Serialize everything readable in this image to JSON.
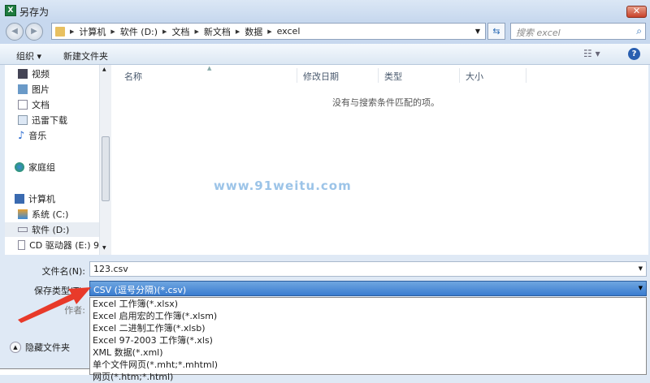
{
  "window": {
    "title": "另存为",
    "app_icon": "X",
    "close": "✕"
  },
  "address": {
    "crumbs": [
      "计算机",
      "软件 (D:)",
      "文档",
      "新文档",
      "数据",
      "excel"
    ],
    "search_placeholder": "搜索 excel"
  },
  "toolbar": {
    "organize": "组织 ▾",
    "new_folder": "新建文件夹"
  },
  "nav": {
    "items": [
      "视频",
      "图片",
      "文档",
      "迅雷下载",
      "音乐",
      "家庭组",
      "计算机",
      "系统 (C:)",
      "软件 (D:)",
      "CD 驱动器 (E:) 9"
    ]
  },
  "columns": [
    "名称",
    "修改日期",
    "类型",
    "大小"
  ],
  "empty_message": "没有与搜索条件匹配的项。",
  "watermark": "www.91weitu.com",
  "form": {
    "filename_label": "文件名(N):",
    "filename": "123.csv",
    "type_label": "保存类型(T):",
    "type_value": "CSV (逗号分隔)(*.csv)",
    "author_label": "作者:",
    "hide_folders": "隐藏文件夹"
  },
  "type_options": [
    "Excel 工作簿(*.xlsx)",
    "Excel 启用宏的工作簿(*.xlsm)",
    "Excel 二进制工作簿(*.xlsb)",
    "Excel 97-2003 工作簿(*.xls)",
    "XML 数据(*.xml)",
    "单个文件网页(*.mht;*.mhtml)",
    "网页(*.htm;*.html)"
  ],
  "colors": {
    "highlight": "#3a7cd0",
    "arrow": "#e83a2a",
    "close": "#c8422a"
  }
}
